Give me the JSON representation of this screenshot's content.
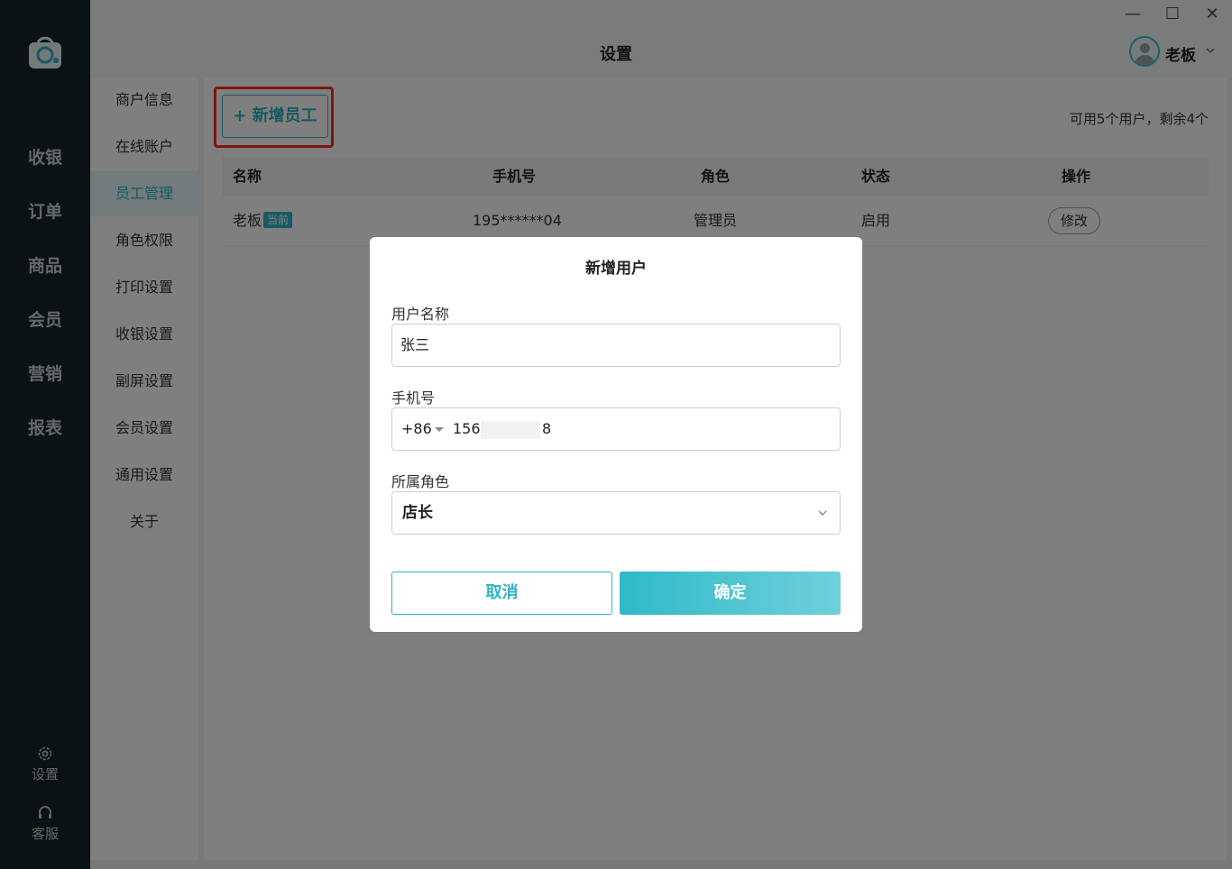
{
  "window": {
    "title": "设置",
    "minimize_label": "—",
    "maximize_label": "☐",
    "close_label": "✕"
  },
  "user": {
    "name": "老板",
    "avatar_icon": "avatar-icon"
  },
  "nav": {
    "items": [
      {
        "label": "收银"
      },
      {
        "label": "订单"
      },
      {
        "label": "商品"
      },
      {
        "label": "会员"
      },
      {
        "label": "营销"
      },
      {
        "label": "报表"
      }
    ],
    "settings_label": "设置",
    "service_label": "客服"
  },
  "submenu": {
    "items": [
      {
        "label": "商户信息"
      },
      {
        "label": "在线账户"
      },
      {
        "label": "员工管理"
      },
      {
        "label": "角色权限"
      },
      {
        "label": "打印设置"
      },
      {
        "label": "收银设置"
      },
      {
        "label": "副屏设置"
      },
      {
        "label": "会员设置"
      },
      {
        "label": "通用设置"
      },
      {
        "label": "关于"
      }
    ],
    "active_index": 2
  },
  "content": {
    "add_button": "+ 新增员工",
    "quota_text": "可用5个用户，剩余4个",
    "table": {
      "columns": [
        "名称",
        "手机号",
        "角色",
        "状态",
        "操作"
      ],
      "rows": [
        {
          "name": "老板",
          "badge": "当前",
          "phone": "195******04",
          "role": "管理员",
          "status": "启用",
          "action": "修改"
        }
      ]
    }
  },
  "modal": {
    "title": "新增用户",
    "name_label": "用户名称",
    "name_value": "张三",
    "phone_label": "手机号",
    "country_code": "+86",
    "phone_prefix": "156",
    "phone_suffix": "8",
    "role_label": "所属角色",
    "role_value": "店长",
    "cancel_label": "取消",
    "confirm_label": "确定"
  },
  "colors": {
    "accent": "#2fb4c4",
    "nav_bg": "#15252b",
    "highlight": "#ff2a20"
  }
}
